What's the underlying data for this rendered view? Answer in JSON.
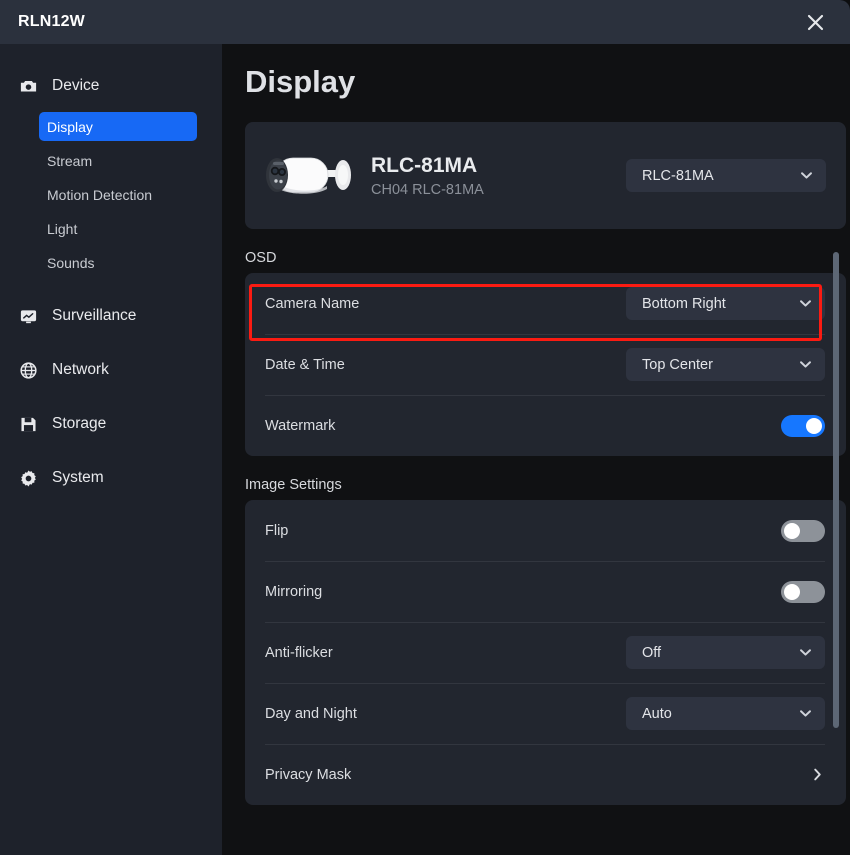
{
  "titlebar": {
    "title": "RLN12W",
    "close_icon": "close-icon"
  },
  "sidebar": {
    "groups": [
      {
        "label": "Device",
        "icon": "camera-icon",
        "items": [
          {
            "label": "Display",
            "active": true
          },
          {
            "label": "Stream",
            "active": false
          },
          {
            "label": "Motion Detection",
            "active": false
          },
          {
            "label": "Light",
            "active": false
          },
          {
            "label": "Sounds",
            "active": false
          }
        ]
      },
      {
        "label": "Surveillance",
        "icon": "monitor-icon",
        "items": []
      },
      {
        "label": "Network",
        "icon": "globe-icon",
        "items": []
      },
      {
        "label": "Storage",
        "icon": "floppy-disk-icon",
        "items": []
      },
      {
        "label": "System",
        "icon": "gear-icon",
        "items": []
      }
    ]
  },
  "main": {
    "page_title": "Display",
    "camera_card": {
      "image_icon": "bullet-camera-image",
      "name": "RLC-81MA",
      "subtitle": "CH04 RLC-81MA",
      "channel_select": {
        "value": "RLC-81MA",
        "chevron_icon": "chevron-down-icon"
      }
    },
    "osd": {
      "section_label": "OSD",
      "rows": [
        {
          "label": "Camera Name",
          "control": "select",
          "value": "Bottom Right",
          "chevron_icon": "chevron-down-icon",
          "highlighted": true
        },
        {
          "label": "Date & Time",
          "control": "select",
          "value": "Top Center",
          "chevron_icon": "chevron-down-icon",
          "highlighted": false
        },
        {
          "label": "Watermark",
          "control": "toggle",
          "value": "on",
          "highlighted": false
        }
      ]
    },
    "image_settings": {
      "section_label": "Image Settings",
      "rows": [
        {
          "label": "Flip",
          "control": "toggle",
          "value": "off"
        },
        {
          "label": "Mirroring",
          "control": "toggle",
          "value": "off"
        },
        {
          "label": "Anti-flicker",
          "control": "select",
          "value": "Off",
          "chevron_icon": "chevron-down-icon"
        },
        {
          "label": "Day and Night",
          "control": "select",
          "value": "Auto",
          "chevron_icon": "chevron-down-icon"
        },
        {
          "label": "Privacy Mask",
          "control": "navigate",
          "chevron_icon": "chevron-right-icon"
        }
      ]
    }
  },
  "annotation": {
    "highlight_color": "#fb1b12",
    "target": "Camera Name"
  },
  "colors": {
    "accent": "#1677ff",
    "sidebar_active": "#1769f5",
    "titlebar_bg": "#2b313d",
    "sidebar_bg": "#1e222b",
    "content_bg": "#101113",
    "card_bg": "#22262f",
    "select_bg": "#2e3340",
    "toggle_off": "#8d9299",
    "scrollbar_thumb": "#5d6775"
  },
  "scrollbar": {
    "name": "vertical-scrollbar"
  }
}
